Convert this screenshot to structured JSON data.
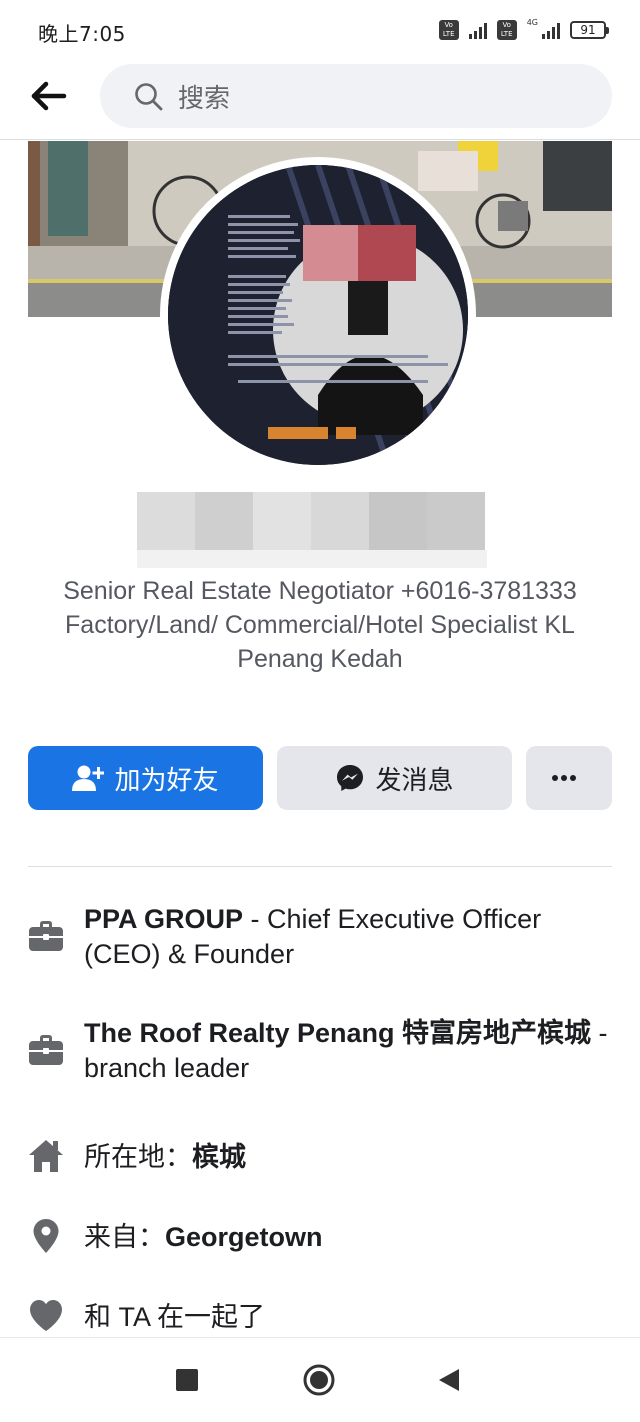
{
  "status_bar": {
    "time": "晚上7:05",
    "volte_1": "Vo LTE",
    "volte_2": "Vo LTE",
    "network": "4G",
    "battery": "91"
  },
  "topnav": {
    "search_placeholder": "搜索"
  },
  "profile": {
    "bio": "Senior Real Estate Negotiator +6016-3781333 Factory/Land/ Commercial/Hotel Specialist KL Penang Kedah"
  },
  "actions": {
    "add_friend_label": "加为好友",
    "message_label": "发消息",
    "more_label": "···"
  },
  "info": {
    "work1_company": "PPA GROUP",
    "work1_role": " - Chief Executive Officer (CEO) & Founder",
    "work2_company": "The Roof Realty Penang 特富房地产槟城",
    "work2_role": " - branch leader",
    "lives_prefix": "所在地：",
    "lives_value": "槟城",
    "from_prefix": "来自：",
    "from_value": "Georgetown",
    "relationship": "和 TA 在一起了"
  },
  "colors": {
    "primary_blue": "#1b74e4",
    "button_grey": "#e4e6eb",
    "icon_grey": "#65676b"
  },
  "icons": {
    "back": "arrow-left-icon",
    "search": "search-icon",
    "add_friend": "add-friend-icon",
    "messenger": "messenger-icon",
    "more": "more-dots-icon",
    "work": "briefcase-icon",
    "home": "home-icon",
    "location": "location-pin-icon",
    "relationship": "heart-icon",
    "nav_recents": "square-icon",
    "nav_home": "circle-icon",
    "nav_back": "triangle-back-icon"
  }
}
